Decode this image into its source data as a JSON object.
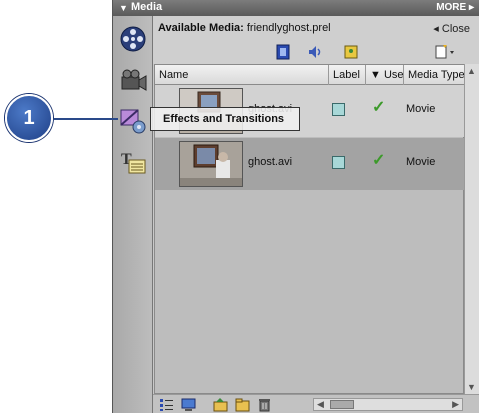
{
  "panel": {
    "title": "Media",
    "more_label": "MORE",
    "available_label": "Available Media:",
    "project_file": "friendlyghost.prel",
    "close_label": "Close"
  },
  "columns": [
    "Name",
    "Label",
    "Used",
    "Media Type"
  ],
  "rows": [
    {
      "name": "ghost.avi",
      "media_type": "Movie",
      "label_color": "#a8d8d8",
      "used": true
    },
    {
      "name": "ghost.avi",
      "media_type": "Movie",
      "label_color": "#a8d8d8",
      "used": true
    }
  ],
  "tooltip": {
    "text": "Effects and Transitions"
  },
  "callout": {
    "number": "1"
  },
  "rail_icons": [
    "film-reel-icon",
    "camera-icon",
    "effects-icon",
    "titles-icon"
  ],
  "tool_icons": [
    "video-filter-icon",
    "audio-filter-icon",
    "still-image-filter-icon",
    "new-item-icon"
  ],
  "bottom_icons": [
    "list-view-icon",
    "icon-view-icon",
    "folder-up-icon",
    "new-folder-icon",
    "delete-icon"
  ],
  "colors": {
    "accent": "#2a4a8a",
    "check": "#3c9a2a"
  }
}
